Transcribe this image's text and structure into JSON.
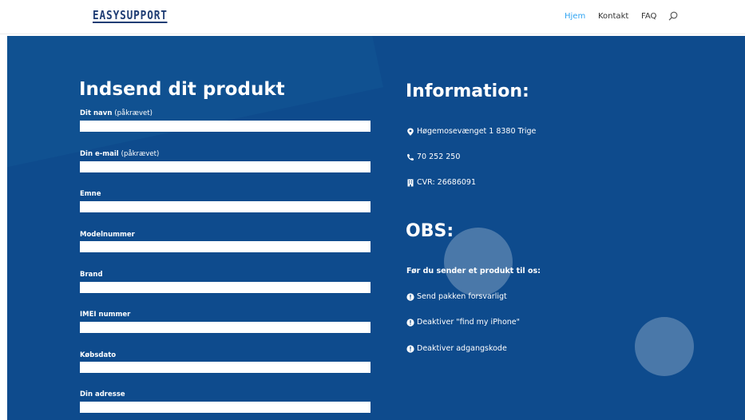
{
  "header": {
    "logo_text": "EASYSUPPORT",
    "nav": [
      "Hjem",
      "Kontakt",
      "FAQ"
    ],
    "active_color": "#2ea3f2"
  },
  "form": {
    "title": "Indsend dit produkt",
    "required_suffix": "(påkrævet)",
    "fields": [
      {
        "label": "Dit navn",
        "required": true
      },
      {
        "label": "Din e-mail",
        "required": true
      },
      {
        "label": "Emne",
        "required": false
      },
      {
        "label": "Modelnummer",
        "required": false
      },
      {
        "label": "Brand",
        "required": false
      },
      {
        "label": "IMEI nummer",
        "required": false
      },
      {
        "label": "Købsdato",
        "required": false
      },
      {
        "label": "Din adresse",
        "required": false
      }
    ]
  },
  "info": {
    "title": "Information:",
    "address": "Høgemosevænget 1 8380 Trige",
    "phone": "70 252 250",
    "cvr": "CVR: 26686091"
  },
  "obs": {
    "title": "OBS:",
    "subtitle": "Før du sender et produkt til os:",
    "items": [
      "Send pakken forsvarligt",
      "Deaktiver \"find my iPhone\"",
      "Deaktiver adgangskode"
    ]
  },
  "colors": {
    "hero_background": "#0e4b8d",
    "logo": "#1f3d74"
  },
  "icons": [
    "search-icon",
    "map-marker-icon",
    "phone-icon",
    "building-icon",
    "exclamation-circle-icon"
  ]
}
